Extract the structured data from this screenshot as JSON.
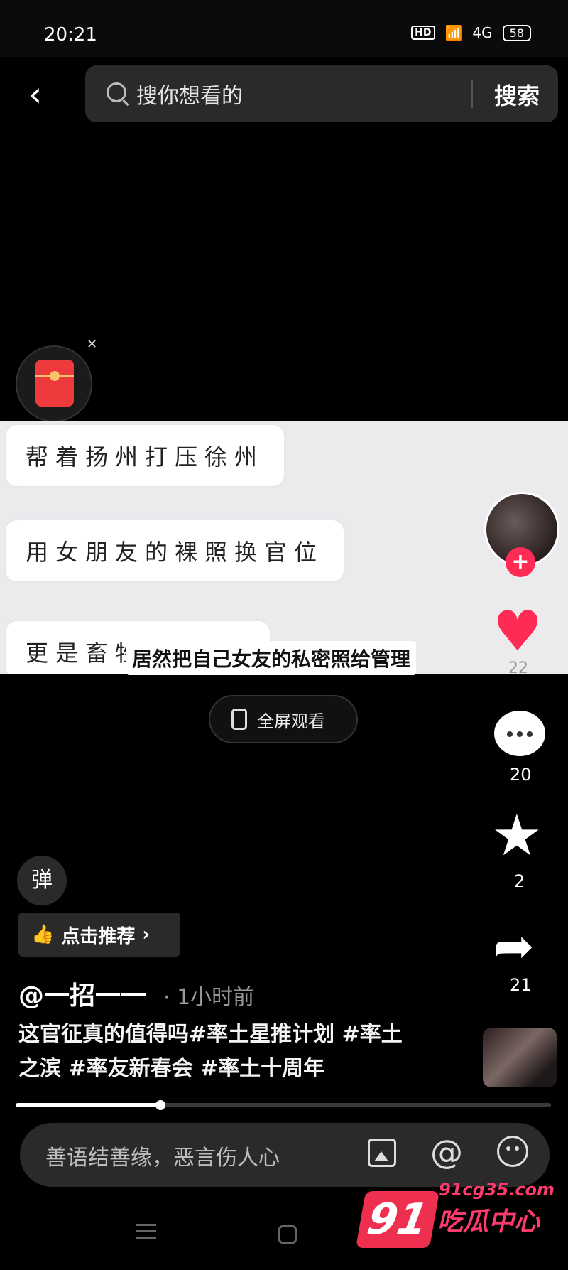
{
  "status_bar": {
    "time": "20:21",
    "hd": "HD",
    "network": "4G",
    "battery": "58"
  },
  "search": {
    "placeholder": "搜你想看的",
    "button_label": "搜索"
  },
  "video": {
    "bubbles": [
      "帮着扬州打压徐州",
      "用女朋友的裸照换官位",
      "更是畜牲"
    ],
    "caption": "居然把自己女友的私密照给管理",
    "fullscreen_label": "全屏观看"
  },
  "actions": {
    "likes": "22",
    "comments": "20",
    "favorites": "2",
    "shares": "21"
  },
  "post": {
    "danmu_label": "弹",
    "recommend_label": "点击推荐",
    "author": "@一招一一",
    "time_ago": "· 1小时前",
    "description": "这官征真的值得吗#率土星推计划 #率土之滨 #率友新春会 #率土十周年"
  },
  "playback": {
    "progress": 0.27
  },
  "comment_input": {
    "placeholder": "善语结善缘，恶言伤人心"
  },
  "watermark": {
    "number": "91",
    "url": "91cg35.com",
    "brand": "吃瓜中心"
  },
  "colors": {
    "accent": "#fe2c55",
    "background": "#000000"
  }
}
